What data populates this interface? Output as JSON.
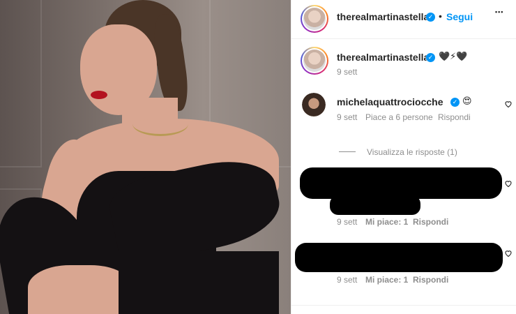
{
  "post": {
    "author": "therealmartinastella",
    "separator": "•",
    "follow_label": "Segui",
    "more_label": "•••"
  },
  "caption": {
    "author": "therealmartinastella",
    "emojis": "🖤⚡🖤",
    "time": "9 sett"
  },
  "comments": [
    {
      "author": "michelaquattrociocche",
      "emoji": "😍",
      "time": "9 sett",
      "likes": "Piace a 6 persone",
      "reply_label": "Rispondi",
      "view_replies": "Visualizza le risposte (1)"
    },
    {
      "time": "9 sett",
      "likes": "Mi piace: 1",
      "reply_label": "Rispondi"
    },
    {
      "time": "9 sett",
      "likes": "Mi piace: 1",
      "reply_label": "Rispondi"
    }
  ],
  "colors": {
    "link_blue": "#0095f6",
    "verified_blue": "#0095f6",
    "muted_gray": "#8e8e8e",
    "text_dark": "#262626"
  },
  "icons": {
    "verified": "verified-badge-icon",
    "like": "heart-outline-icon",
    "more": "more-options-icon"
  }
}
